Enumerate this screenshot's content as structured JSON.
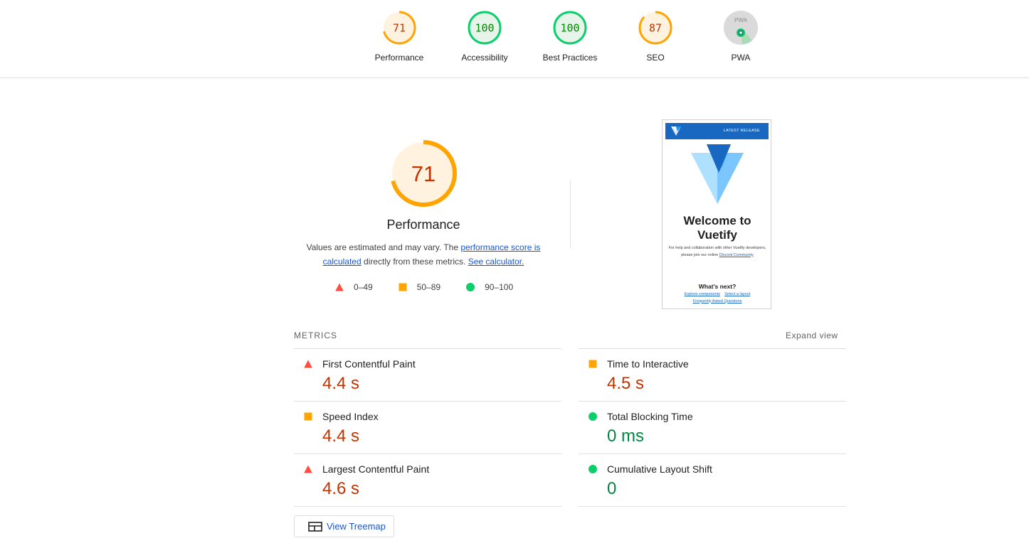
{
  "gauges": [
    {
      "label": "Performance",
      "score": "71",
      "color": "#ffa400",
      "fill": "#fff3e0",
      "text": "#c33300",
      "fraction": 0.71
    },
    {
      "label": "Accessibility",
      "score": "100",
      "color": "#0cce6b",
      "fill": "#e6f4ea",
      "text": "#008800",
      "fraction": 1.0
    },
    {
      "label": "Best Practices",
      "score": "100",
      "color": "#0cce6b",
      "fill": "#e6f4ea",
      "text": "#008800",
      "fraction": 1.0
    },
    {
      "label": "SEO",
      "score": "87",
      "color": "#ffa400",
      "fill": "#fff3e0",
      "text": "#c33300",
      "fraction": 0.87
    },
    {
      "label": "PWA",
      "badge": "PWA"
    }
  ],
  "performance": {
    "score": "71",
    "title": "Performance",
    "desc_prefix": "Values are estimated and may vary. The ",
    "desc_link1": "performance score is calculated",
    "desc_mid": " directly from these metrics. ",
    "desc_link2": "See calculator.",
    "legend": [
      "0–49",
      "50–89",
      "90–100"
    ]
  },
  "thumbnail": {
    "release": "LATEST RELEASE",
    "welcome_1": "Welcome to",
    "welcome_2": "Vuetify",
    "help_1": "For help and collaboration with other Vuetify developers,",
    "help_2": "please join our online ",
    "help_link": "Discord Community",
    "next": "What's next?",
    "link1": "Explore components",
    "link2": "Select a layout",
    "link3": "Frequently Asked Questions"
  },
  "metrics": {
    "header": "METRICS",
    "expand": "Expand view",
    "left": [
      {
        "title": "First Contentful Paint",
        "value": "4.4 s",
        "status": "fail"
      },
      {
        "title": "Speed Index",
        "value": "4.4 s",
        "status": "average"
      },
      {
        "title": "Largest Contentful Paint",
        "value": "4.6 s",
        "status": "fail"
      }
    ],
    "right": [
      {
        "title": "Time to Interactive",
        "value": "4.5 s",
        "status": "average"
      },
      {
        "title": "Total Blocking Time",
        "value": "0 ms",
        "status": "pass"
      },
      {
        "title": "Cumulative Layout Shift",
        "value": "0",
        "status": "pass"
      }
    ]
  },
  "treemap": {
    "label": "View Treemap"
  },
  "colors": {
    "fail": "#ff4e42",
    "average": "#ffa400",
    "pass": "#0cce6b",
    "link": "#1a55cf"
  }
}
